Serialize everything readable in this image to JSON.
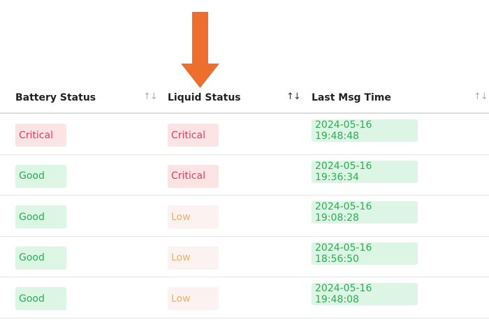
{
  "colors": {
    "arrow": "#ec6f2d",
    "critical_bg": "#fce4e4",
    "critical_text": "#e0435b",
    "good_bg": "#dcf5e4",
    "good_text": "#2ab052",
    "low_bg": "#fdf2f2",
    "low_text": "#f0b060"
  },
  "columns": [
    {
      "label": "Battery Status",
      "sort_icon": "↑↓"
    },
    {
      "label": "Liquid Status",
      "sort_icon": "↑↓"
    },
    {
      "label": "Last Msg Time",
      "sort_icon": "↑↓"
    }
  ],
  "rows": [
    {
      "battery": "Critical",
      "liquid": "Critical",
      "time": "2024-05-16 19:48:48"
    },
    {
      "battery": "Good",
      "liquid": "Critical",
      "time": "2024-05-16 19:36:34"
    },
    {
      "battery": "Good",
      "liquid": "Low",
      "time": "2024-05-16 19:08:28"
    },
    {
      "battery": "Good",
      "liquid": "Low",
      "time": "2024-05-16 18:56:50"
    },
    {
      "battery": "Good",
      "liquid": "Low",
      "time": "2024-05-16 19:48:08"
    }
  ]
}
